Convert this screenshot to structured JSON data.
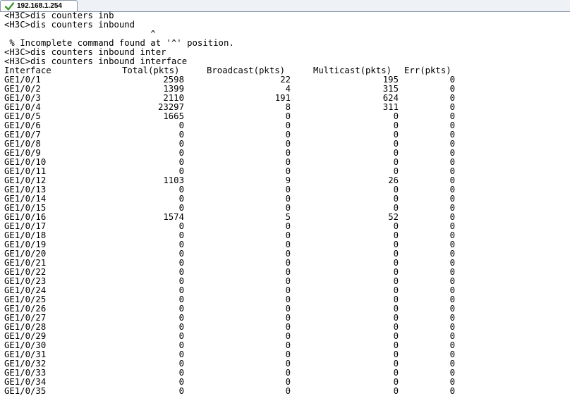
{
  "tab": {
    "title": "192.168.1.254",
    "status_icon": "check-icon",
    "status_color": "#3a9a2e"
  },
  "terminal": {
    "lines": [
      "<H3C>dis counters inb",
      "<H3C>dis counters inbound",
      "                            ^",
      " % Incomplete command found at '^' position.",
      "<H3C>dis counters inbound inter",
      "<H3C>dis counters inbound interface"
    ],
    "header": {
      "interface": "Interface",
      "total": "Total(pkts)",
      "broadcast": "Broadcast(pkts)",
      "multicast": "Multicast(pkts)",
      "err": "Err(pkts)"
    },
    "rows": [
      [
        "GE1/0/1",
        "2598",
        "22",
        "195",
        "0"
      ],
      [
        "GE1/0/2",
        "1399",
        "4",
        "315",
        "0"
      ],
      [
        "GE1/0/3",
        "2110",
        "191",
        "624",
        "0"
      ],
      [
        "GE1/0/4",
        "23297",
        "8",
        "311",
        "0"
      ],
      [
        "GE1/0/5",
        "1665",
        "0",
        "0",
        "0"
      ],
      [
        "GE1/0/6",
        "0",
        "0",
        "0",
        "0"
      ],
      [
        "GE1/0/7",
        "0",
        "0",
        "0",
        "0"
      ],
      [
        "GE1/0/8",
        "0",
        "0",
        "0",
        "0"
      ],
      [
        "GE1/0/9",
        "0",
        "0",
        "0",
        "0"
      ],
      [
        "GE1/0/10",
        "0",
        "0",
        "0",
        "0"
      ],
      [
        "GE1/0/11",
        "0",
        "0",
        "0",
        "0"
      ],
      [
        "GE1/0/12",
        "1103",
        "9",
        "26",
        "0"
      ],
      [
        "GE1/0/13",
        "0",
        "0",
        "0",
        "0"
      ],
      [
        "GE1/0/14",
        "0",
        "0",
        "0",
        "0"
      ],
      [
        "GE1/0/15",
        "0",
        "0",
        "0",
        "0"
      ],
      [
        "GE1/0/16",
        "1574",
        "5",
        "52",
        "0"
      ],
      [
        "GE1/0/17",
        "0",
        "0",
        "0",
        "0"
      ],
      [
        "GE1/0/18",
        "0",
        "0",
        "0",
        "0"
      ],
      [
        "GE1/0/19",
        "0",
        "0",
        "0",
        "0"
      ],
      [
        "GE1/0/20",
        "0",
        "0",
        "0",
        "0"
      ],
      [
        "GE1/0/21",
        "0",
        "0",
        "0",
        "0"
      ],
      [
        "GE1/0/22",
        "0",
        "0",
        "0",
        "0"
      ],
      [
        "GE1/0/23",
        "0",
        "0",
        "0",
        "0"
      ],
      [
        "GE1/0/24",
        "0",
        "0",
        "0",
        "0"
      ],
      [
        "GE1/0/25",
        "0",
        "0",
        "0",
        "0"
      ],
      [
        "GE1/0/26",
        "0",
        "0",
        "0",
        "0"
      ],
      [
        "GE1/0/27",
        "0",
        "0",
        "0",
        "0"
      ],
      [
        "GE1/0/28",
        "0",
        "0",
        "0",
        "0"
      ],
      [
        "GE1/0/29",
        "0",
        "0",
        "0",
        "0"
      ],
      [
        "GE1/0/30",
        "0",
        "0",
        "0",
        "0"
      ],
      [
        "GE1/0/31",
        "0",
        "0",
        "0",
        "0"
      ],
      [
        "GE1/0/32",
        "0",
        "0",
        "0",
        "0"
      ],
      [
        "GE1/0/33",
        "0",
        "0",
        "0",
        "0"
      ],
      [
        "GE1/0/34",
        "0",
        "0",
        "0",
        "0"
      ],
      [
        "GE1/0/35",
        "0",
        "0",
        "0",
        "0"
      ]
    ]
  }
}
